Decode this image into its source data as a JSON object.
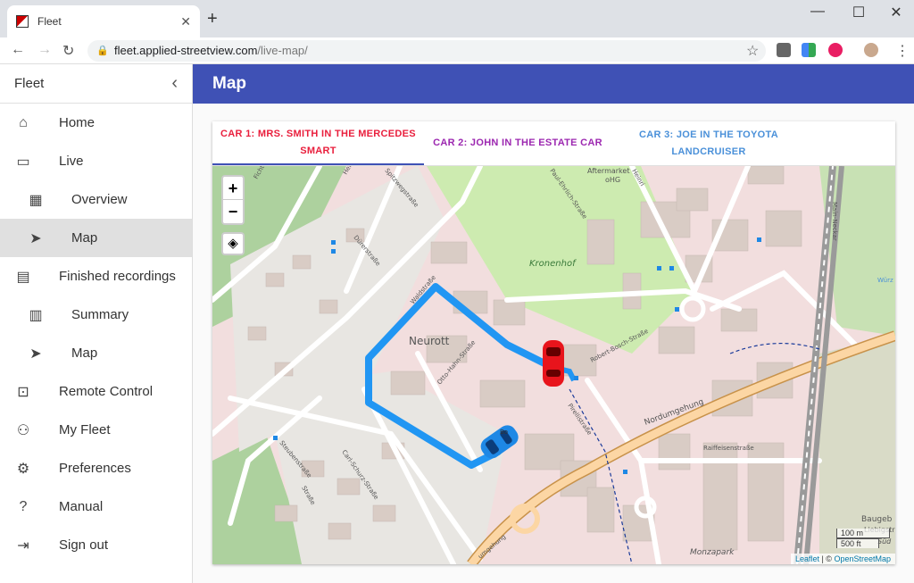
{
  "browser": {
    "tab_title": "Fleet",
    "tab_close": "✕",
    "new_tab": "+",
    "url_host": "fleet.applied-streetview.com",
    "url_path": "/live-map/"
  },
  "sidebar": {
    "title": "Fleet",
    "collapse_icon": "‹",
    "items": [
      {
        "label": "Home",
        "icon": "home-icon",
        "glyph": "⌂"
      },
      {
        "label": "Live",
        "icon": "tv-icon",
        "glyph": "▭"
      },
      {
        "label": "Overview",
        "icon": "dashboard-icon",
        "glyph": "▦"
      },
      {
        "label": "Map",
        "icon": "navigation-icon",
        "glyph": "➤"
      },
      {
        "label": "Finished recordings",
        "icon": "clipboard-icon",
        "glyph": "▤"
      },
      {
        "label": "Summary",
        "icon": "bar-chart-icon",
        "glyph": "▥"
      },
      {
        "label": "Map",
        "icon": "navigation-icon",
        "glyph": "➤"
      },
      {
        "label": "Remote Control",
        "icon": "remote-icon",
        "glyph": "⊡"
      },
      {
        "label": "My Fleet",
        "icon": "people-icon",
        "glyph": "⚇"
      },
      {
        "label": "Preferences",
        "icon": "gear-icon",
        "glyph": "⚙"
      },
      {
        "label": "Manual",
        "icon": "help-icon",
        "glyph": "?"
      },
      {
        "label": "Sign out",
        "icon": "exit-icon",
        "glyph": "⇥"
      }
    ]
  },
  "appbar": {
    "title": "Map"
  },
  "car_tabs": [
    {
      "label": "CAR 1: MRS. SMITH IN THE MERCEDES SMART"
    },
    {
      "label": "CAR 2: JOHN IN THE ESTATE CAR"
    },
    {
      "label": "CAR 3: JOE IN THE TOYOTA LANDCRUISER"
    }
  ],
  "map": {
    "zoom_in": "+",
    "zoom_out": "−",
    "labels": {
      "neurott": "Neurott",
      "kronenhof": "Kronenhof",
      "nordumgehung": "Nordumgehung",
      "robert_bosch": "Robert-Bosch-Straße",
      "otto_hahn": "Otto-Hahn-Straße",
      "carl_schurz": "Carl-Schurz-Straße",
      "steubenstrasse": "Steubenstraße",
      "raiffeisenstrasse": "Raiffeisenstraße",
      "monzapark": "Monzapark",
      "aftermarket": "Aftermarket",
      "aftermarket2": "oHG",
      "pirelli": "Pirellistraße",
      "paul_ehrlich": "Paul-Ehrlich-Straße",
      "durerstrasse": "Dürerstraße",
      "bosch_short": "Bo",
      "baugeb": "Baugeb",
      "liebigstr": "Liebigstr",
      "sud": "Süd",
      "umgehung": "umgehung",
      "wurz": "Würz",
      "hermann": "Hermann",
      "heinrich": "Heinri",
      "main_neckar": "Main-Neckar",
      "spitzweg": "Spitzwegstraße",
      "wald": "Waldstraße",
      "fichte": "Fichte",
      "strasse": "Straße"
    },
    "scale_m": "100 m",
    "scale_ft": "500 ft",
    "attribution_leaflet": "Leaflet",
    "attribution_sep": " | © ",
    "attribution_osm": "OpenStreetMap"
  },
  "colors": {
    "appbar": "#3f51b5",
    "route": "#2196f3",
    "car_active": "#e8141c",
    "car_blue": "#1e88e5"
  }
}
